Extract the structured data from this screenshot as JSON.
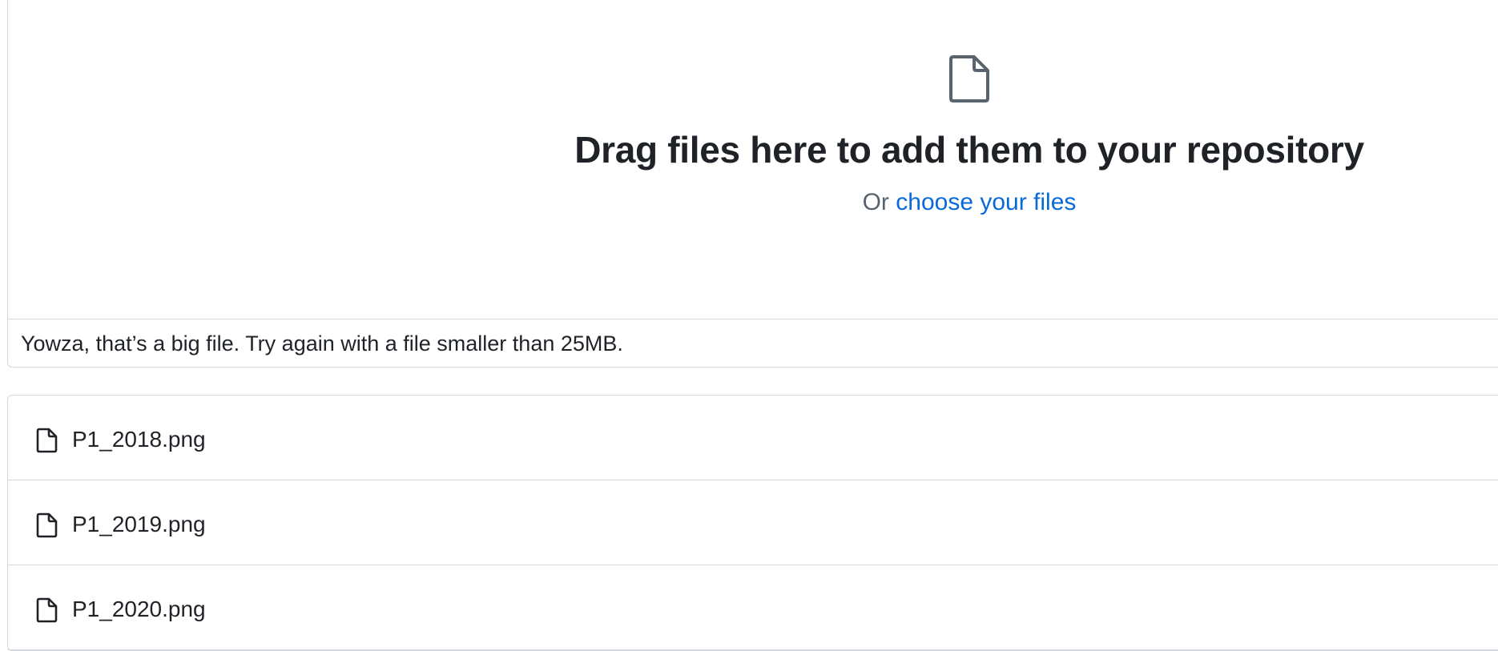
{
  "dropzone": {
    "icon": "file-icon",
    "title": "Drag files here to add them to your repository",
    "prefix": "Or",
    "link_label": "choose your files"
  },
  "error": {
    "message": "Yowza, that’s a big file. Try again with a file smaller than 25MB."
  },
  "files": [
    {
      "name": "P1_2018.png",
      "icon": "file-icon"
    },
    {
      "name": "P1_2019.png",
      "icon": "file-icon"
    },
    {
      "name": "P1_2020.png",
      "icon": "file-icon"
    }
  ],
  "colors": {
    "link": "#0969da",
    "text": "#1f2328",
    "muted": "#59636e",
    "border": "#d0d7de"
  }
}
